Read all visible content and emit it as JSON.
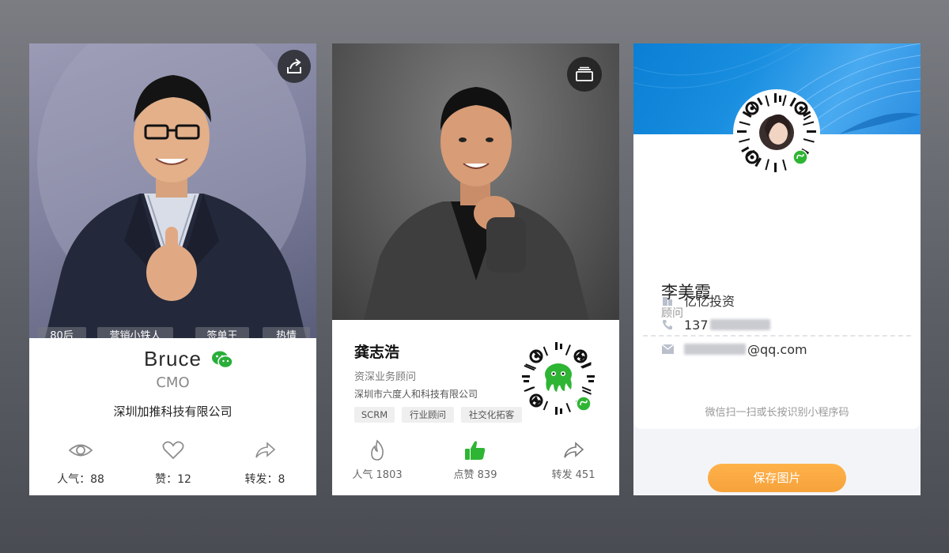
{
  "card1": {
    "tags": [
      "80后",
      "营销小铁人",
      "签单王",
      "热情"
    ],
    "name": "Bruce",
    "title": "CMO",
    "company": "深圳加推科技有限公司",
    "stats": [
      {
        "icon": "eye-icon",
        "label": "人气：88"
      },
      {
        "icon": "heart-icon",
        "label": "赞：12"
      },
      {
        "icon": "share-arrow-icon",
        "label": "转发：8"
      }
    ]
  },
  "card2": {
    "name": "龚志浩",
    "title": "资深业务顾问",
    "company": "深圳市六度人和科技有限公司",
    "tags": [
      "SCRM",
      "行业顾问",
      "社交化拓客"
    ],
    "stats": [
      {
        "icon": "flame-icon",
        "label": "人气 1803"
      },
      {
        "icon": "thumbs-up-icon",
        "label": "点赞 839"
      },
      {
        "icon": "share-arrow-icon",
        "label": "转发 451"
      }
    ],
    "accent_color": "#2fb534"
  },
  "card3": {
    "name": "李美霞",
    "role": "顾问",
    "company": "亿亿投资",
    "phone_visible": "137",
    "email_visible": "@qq.com",
    "hint": "微信扫一扫或长按识别小程序码",
    "save_button": "保存图片",
    "banner_color": "#1a8fe0",
    "button_color": "#f8a83f"
  }
}
